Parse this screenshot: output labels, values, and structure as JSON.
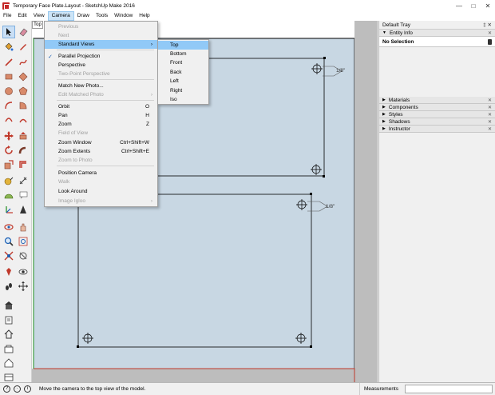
{
  "window": {
    "title": "Temporary Face Plate.Layout - SketchUp Make 2016"
  },
  "menubar": {
    "items": [
      "File",
      "Edit",
      "View",
      "Camera",
      "Draw",
      "Tools",
      "Window",
      "Help"
    ],
    "active_index": 3
  },
  "camera_menu": {
    "items": [
      {
        "label": "Previous",
        "shortcut": "",
        "disabled": true
      },
      {
        "label": "Next",
        "shortcut": "",
        "disabled": true
      },
      {
        "label": "Standard Views",
        "shortcut": "",
        "submenu": true,
        "highlighted": true
      },
      {
        "label": "Parallel Projection",
        "shortcut": "",
        "checked": true
      },
      {
        "label": "Perspective",
        "shortcut": ""
      },
      {
        "label": "Two-Point Perspective",
        "shortcut": "",
        "disabled": true
      },
      {
        "label": "Match New Photo...",
        "shortcut": ""
      },
      {
        "label": "Edit Matched Photo",
        "shortcut": "",
        "submenu": true,
        "disabled": true
      },
      {
        "label": "Orbit",
        "shortcut": "O"
      },
      {
        "label": "Pan",
        "shortcut": "H"
      },
      {
        "label": "Zoom",
        "shortcut": "Z"
      },
      {
        "label": "Field of View",
        "shortcut": "",
        "disabled": true
      },
      {
        "label": "Zoom Window",
        "shortcut": "Ctrl+Shift+W"
      },
      {
        "label": "Zoom Extents",
        "shortcut": "Ctrl+Shift+E"
      },
      {
        "label": "Zoom to Photo",
        "shortcut": "",
        "disabled": true
      },
      {
        "label": "Position Camera",
        "shortcut": ""
      },
      {
        "label": "Walk",
        "shortcut": "",
        "disabled": true
      },
      {
        "label": "Look Around",
        "shortcut": ""
      },
      {
        "label": "Image Igloo",
        "shortcut": "",
        "submenu": true,
        "disabled": true
      }
    ]
  },
  "standard_views_submenu": {
    "items": [
      "Top",
      "Bottom",
      "Front",
      "Back",
      "Left",
      "Right",
      "Iso"
    ],
    "highlighted_index": 0
  },
  "viewport": {
    "scene_tab": "Top",
    "dimension_label": "1/8\"",
    "background": "#c8d7e3"
  },
  "tray": {
    "title": "Default Tray",
    "entity_info": {
      "label": "Entity Info",
      "selection": "No Selection"
    },
    "panels": [
      "Materials",
      "Components",
      "Styles",
      "Shadows",
      "Instructor"
    ]
  },
  "statusbar": {
    "hint": "Move the camera to the top view of the model.",
    "measurements_label": "Measurements"
  },
  "icons": [
    "select-icon",
    "eraser-icon",
    "paint-bucket-icon",
    "line-icon",
    "freehand-icon",
    "rectangle-icon",
    "circle-icon",
    "arc-icon",
    "push-pull-icon",
    "move-icon",
    "rotate-icon",
    "scale-icon",
    "offset-icon",
    "tape-measure-icon",
    "protractor-icon",
    "text-icon",
    "axes-icon",
    "orbit-icon",
    "pan-icon",
    "zoom-icon",
    "zoom-extents-icon",
    "walk-icon",
    "look-around-icon",
    "warehouse-icon",
    "extension-icon"
  ]
}
